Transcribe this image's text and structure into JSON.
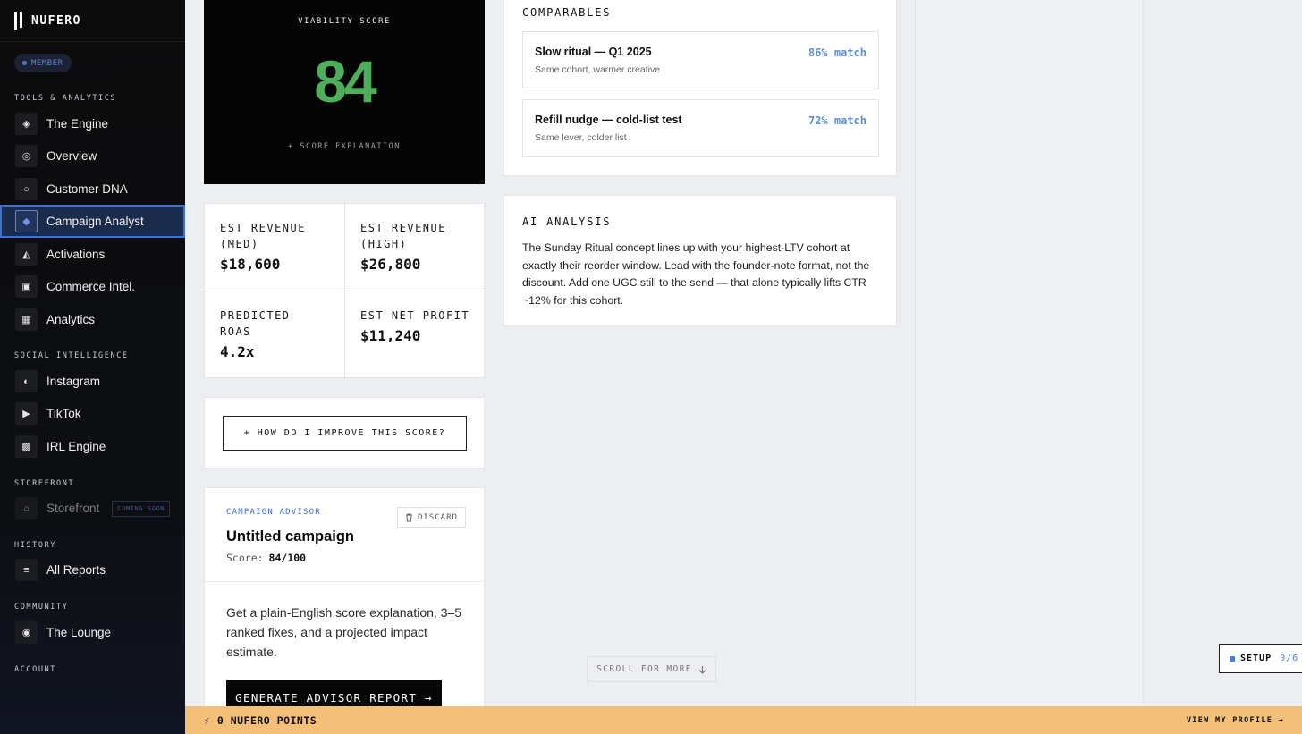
{
  "brand": {
    "name": "NUFERO"
  },
  "member_badge": "MEMBER",
  "sidebar": {
    "sections": [
      {
        "label": "TOOLS & ANALYTICS"
      },
      {
        "label": "SOCIAL INTELLIGENCE"
      },
      {
        "label": "STOREFRONT"
      },
      {
        "label": "HISTORY"
      },
      {
        "label": "COMMUNITY"
      },
      {
        "label": "ACCOUNT"
      }
    ],
    "items": [
      {
        "label": "The Engine",
        "icon": "◈",
        "icon_name": "engine-icon"
      },
      {
        "label": "Overview",
        "icon": "◎",
        "icon_name": "overview-icon"
      },
      {
        "label": "Customer DNA",
        "icon": "○",
        "icon_name": "dna-icon"
      },
      {
        "label": "Campaign Analyst",
        "icon": "◆",
        "icon_name": "campaign-icon",
        "active": true
      },
      {
        "label": "Activations",
        "icon": "◭",
        "icon_name": "activations-icon"
      },
      {
        "label": "Commerce Intel.",
        "icon": "▣",
        "icon_name": "commerce-icon"
      },
      {
        "label": "Analytics",
        "icon": "▦",
        "icon_name": "analytics-icon"
      },
      {
        "label": "Instagram",
        "icon": "◐",
        "icon_name": "instagram-icon"
      },
      {
        "label": "TikTok",
        "icon": "▶",
        "icon_name": "tiktok-icon"
      },
      {
        "label": "IRL Engine",
        "icon": "▩",
        "icon_name": "irl-icon"
      },
      {
        "label": "Storefront",
        "icon": "⌂",
        "icon_name": "storefront-icon",
        "badge": "COMING SOON"
      },
      {
        "label": "All Reports",
        "icon": "≡",
        "icon_name": "reports-icon"
      },
      {
        "label": "The Lounge",
        "icon": "◉",
        "icon_name": "lounge-icon"
      }
    ]
  },
  "score_card": {
    "label": "VIABILITY SCORE",
    "score": "84",
    "explanation_link": "+ SCORE EXPLANATION",
    "score_color": "#4fae5b"
  },
  "metrics": [
    {
      "label": "EST REVENUE (MED)",
      "value": "$18,600"
    },
    {
      "label": "EST REVENUE (HIGH)",
      "value": "$26,800"
    },
    {
      "label": "PREDICTED ROAS",
      "value": "4.2x"
    },
    {
      "label": "EST NET PROFIT",
      "value": "$11,240"
    }
  ],
  "improve_button": "+ HOW DO I IMPROVE THIS SCORE?",
  "advisor": {
    "kicker": "CAMPAIGN ADVISOR",
    "discard": "DISCARD",
    "title": "Untitled campaign",
    "score_label": "Score:",
    "score_value": "84/100",
    "description": "Get a plain-English score explanation, 3–5 ranked fixes, and a projected impact estimate.",
    "generate_button": "GENERATE ADVISOR REPORT →"
  },
  "comparables": {
    "title": "COMPARABLES",
    "rows": [
      {
        "title": "Slow ritual — Q1 2025",
        "subtitle": "Same cohort, warmer creative",
        "match": "86% match"
      },
      {
        "title": "Refill nudge — cold-list test",
        "subtitle": "Same lever, colder list",
        "match": "72% match"
      }
    ]
  },
  "ai_analysis": {
    "title": "AI ANALYSIS",
    "body": "The Sunday Ritual concept lines up with your highest-LTV cohort at exactly their reorder window. Lead with the founder-note format, not the discount. Add one UGC still to the send — that alone typically lifts CTR ~12% for this cohort."
  },
  "scroll_hint": "SCROLL FOR MORE",
  "setup": {
    "label": "SETUP",
    "progress": "0/6"
  },
  "bottom_bar": {
    "points": "⚡ 0 NUFERO POINTS",
    "profile_link": "VIEW MY PROFILE →",
    "color": "#f4bf79"
  },
  "colors": {
    "accent": "#3e6fd1",
    "match": "#5d8fd4"
  }
}
